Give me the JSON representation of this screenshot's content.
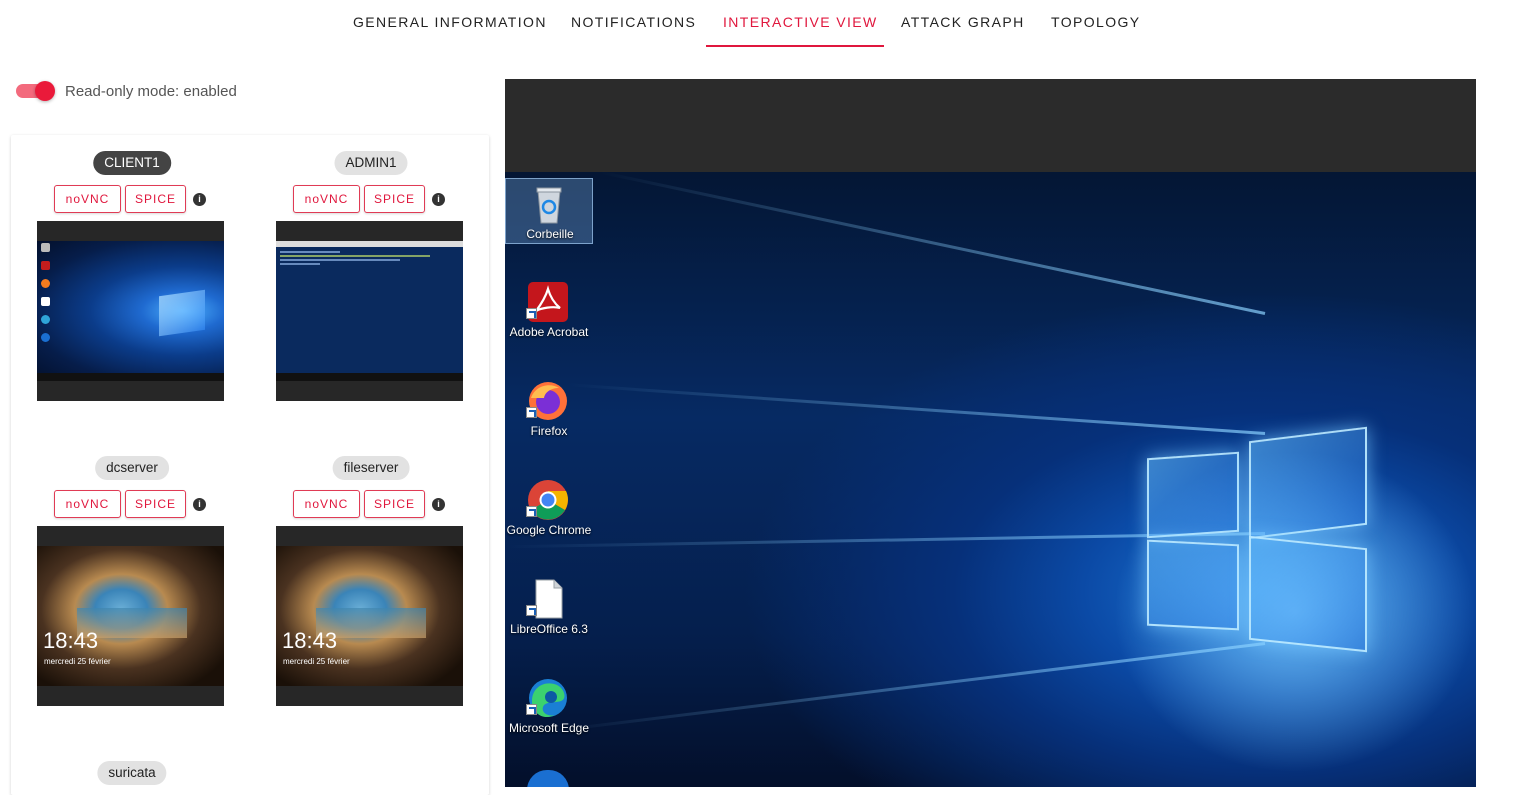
{
  "tabs": [
    {
      "label": "GENERAL INFORMATION",
      "active": false
    },
    {
      "label": "NOTIFICATIONS",
      "active": false
    },
    {
      "label": "INTERACTIVE VIEW",
      "active": true
    },
    {
      "label": "ATTACK GRAPH",
      "active": false
    },
    {
      "label": "TOPOLOGY",
      "active": false
    }
  ],
  "readonly": {
    "label": "Read-only mode: enabled",
    "enabled": true
  },
  "machines": [
    {
      "name": "CLIENT1",
      "selected": true,
      "novnc": "noVNC",
      "spice": "SPICE",
      "info": "i",
      "preview": "windows-desktop"
    },
    {
      "name": "ADMIN1",
      "selected": false,
      "novnc": "noVNC",
      "spice": "SPICE",
      "info": "i",
      "preview": "powershell"
    },
    {
      "name": "dcserver",
      "selected": false,
      "novnc": "noVNC",
      "spice": "SPICE",
      "info": "i",
      "preview": "lock-screen",
      "time": "18:43",
      "date": "mercredi 25 février"
    },
    {
      "name": "fileserver",
      "selected": false,
      "novnc": "noVNC",
      "spice": "SPICE",
      "info": "i",
      "preview": "lock-screen",
      "time": "18:43",
      "date": "mercredi 25 février"
    },
    {
      "name": "suricata",
      "selected": false
    }
  ],
  "desktop": {
    "icons": [
      {
        "label": "Corbeille",
        "icon": "recycle-bin-icon",
        "selected": true
      },
      {
        "label": "Adobe Acrobat",
        "icon": "adobe-acrobat-icon"
      },
      {
        "label": "Firefox",
        "icon": "firefox-icon"
      },
      {
        "label": "Google Chrome",
        "icon": "chrome-icon"
      },
      {
        "label": "LibreOffice 6.3",
        "icon": "libreoffice-icon"
      },
      {
        "label": "Microsoft Edge",
        "icon": "edge-icon"
      }
    ]
  },
  "colors": {
    "accent": "#e0173d",
    "chip_active": "#444444",
    "chip": "#e2e2e2"
  }
}
